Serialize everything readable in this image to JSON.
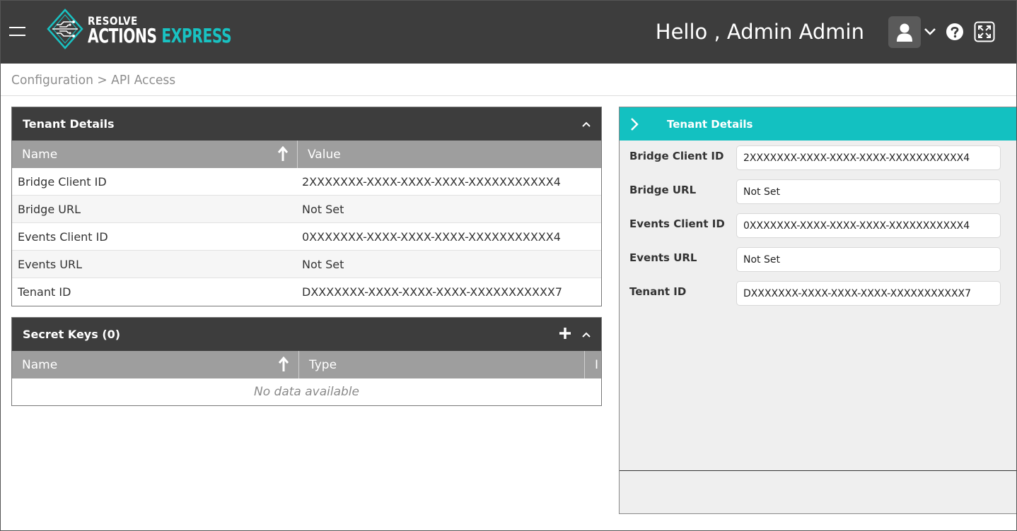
{
  "header": {
    "logo_top": "RESOLVE",
    "logo_word1": "ACTIONS",
    "logo_word2": "EXPRESS",
    "greeting": "Hello , Admin Admin"
  },
  "breadcrumb": "Configuration > API Access",
  "tenant_grid": {
    "title": "Tenant Details",
    "columns": [
      "Name",
      "Value"
    ],
    "rows": [
      {
        "name": "Bridge Client ID",
        "value": "2XXXXXXX-XXXX-XXXX-XXXX-XXXXXXXXXXX4"
      },
      {
        "name": "Bridge URL",
        "value": "Not Set"
      },
      {
        "name": "Events Client ID",
        "value": "0XXXXXXX-XXXX-XXXX-XXXX-XXXXXXXXXXX4"
      },
      {
        "name": "Events URL",
        "value": "Not Set"
      },
      {
        "name": "Tenant ID",
        "value": "DXXXXXXX-XXXX-XXXX-XXXX-XXXXXXXXXXX7"
      }
    ]
  },
  "secret_keys": {
    "title": "Secret Keys (0)",
    "columns": [
      "Name",
      "Type",
      "I"
    ],
    "empty_text": "No data available"
  },
  "details": {
    "title": "Tenant Details",
    "fields": [
      {
        "label": "Bridge Client ID",
        "value": "2XXXXXXX-XXXX-XXXX-XXXX-XXXXXXXXXXX4"
      },
      {
        "label": "Bridge URL",
        "value": "Not Set"
      },
      {
        "label": "Events Client ID",
        "value": "0XXXXXXX-XXXX-XXXX-XXXX-XXXXXXXXXXX4"
      },
      {
        "label": "Events URL",
        "value": "Not Set"
      },
      {
        "label": "Tenant ID",
        "value": "DXXXXXXX-XXXX-XXXX-XXXX-XXXXXXXXXXX7"
      }
    ]
  },
  "colors": {
    "header_bg": "#3d3d3d",
    "accent": "#13c1c1",
    "grid_header_bg": "#9e9e9e"
  }
}
